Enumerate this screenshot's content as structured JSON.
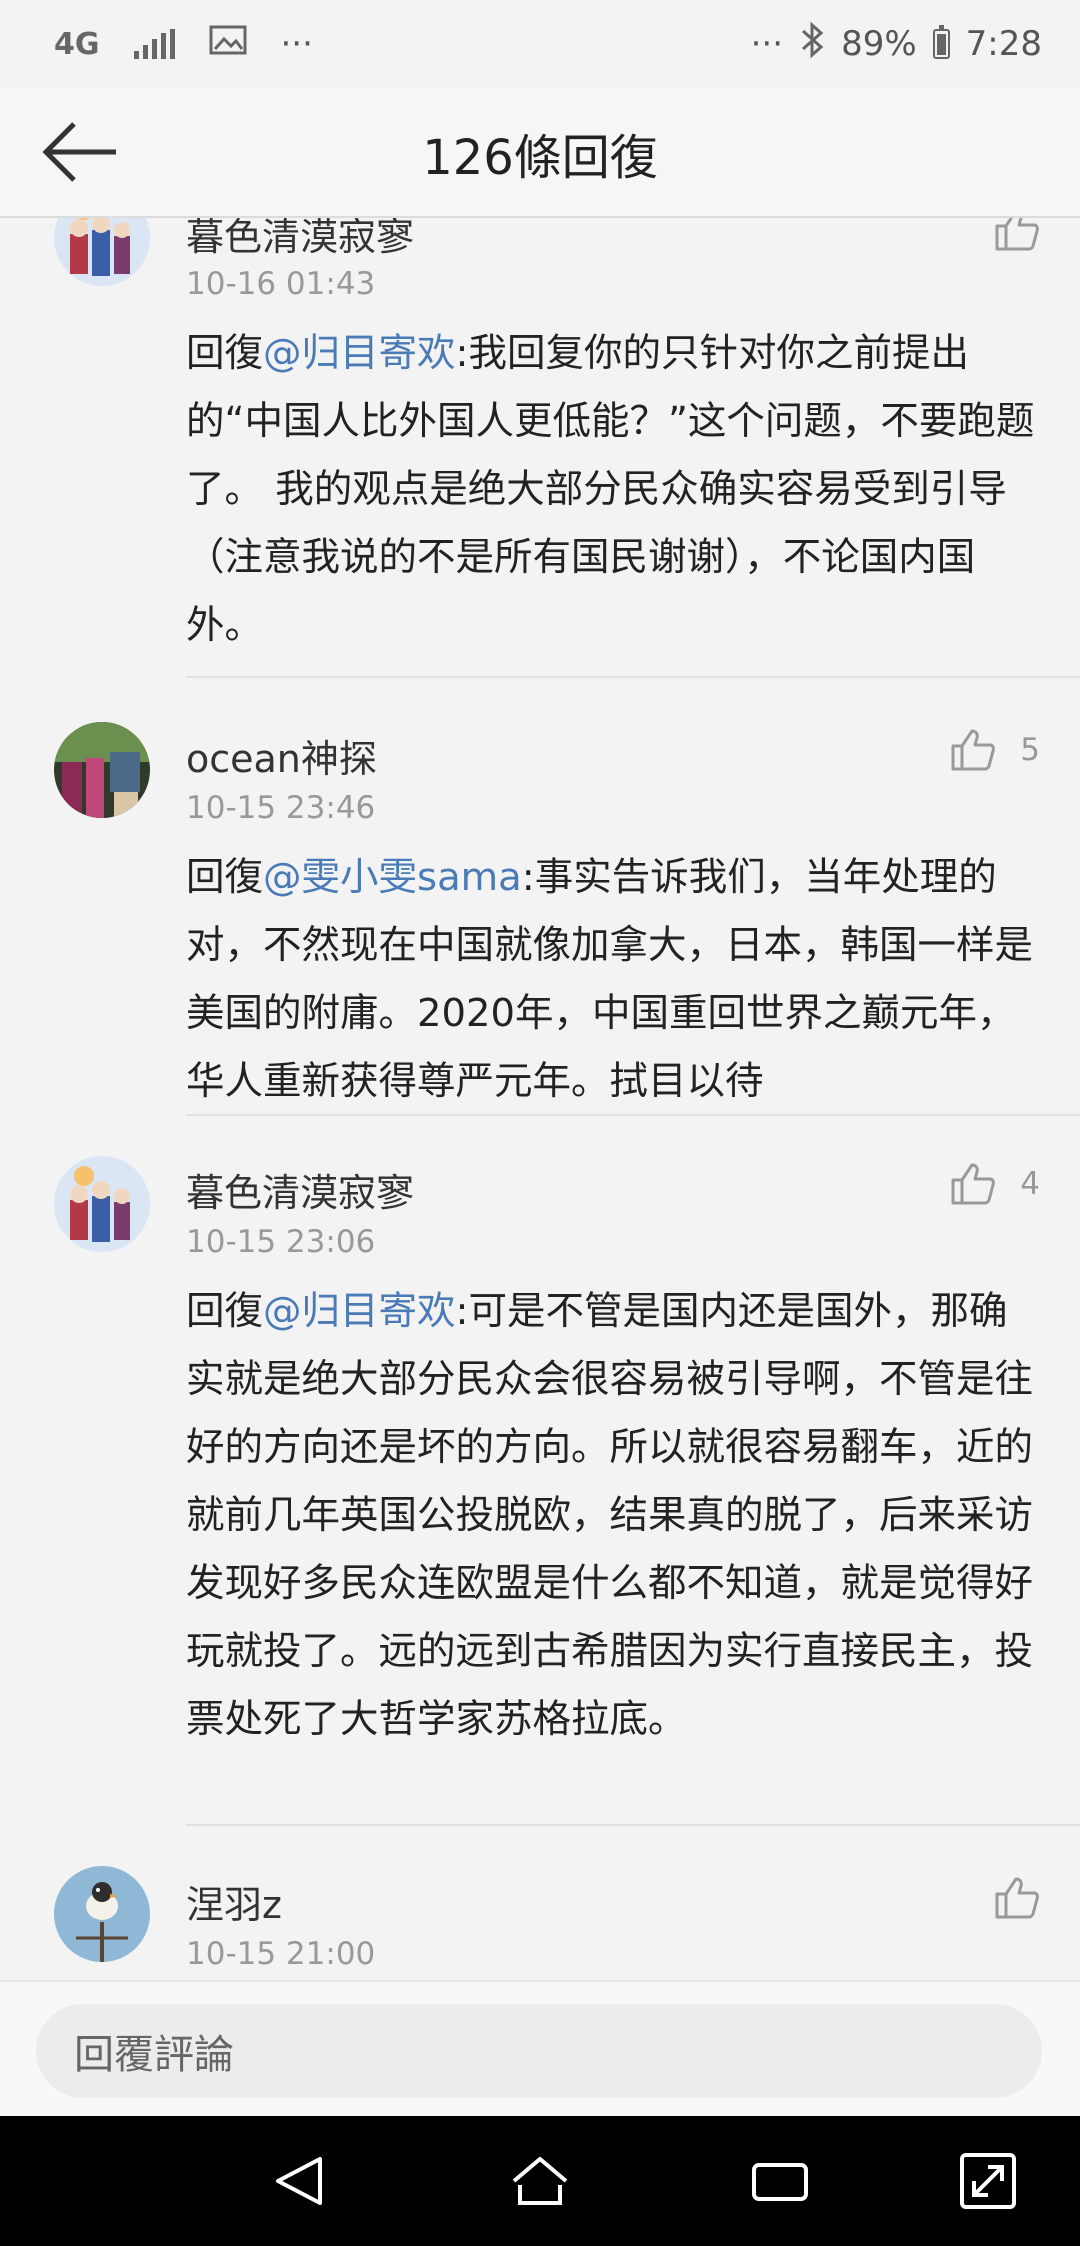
{
  "status_bar": {
    "network": "4G",
    "more": "···",
    "right_more": "···",
    "battery": "89%",
    "time": "7:28"
  },
  "header": {
    "title": "126條回復"
  },
  "comments": [
    {
      "name": "暮色清漠寂寥",
      "time": "10-16 01:43",
      "likes": "",
      "prefix": "回復",
      "mention": "@归目寄欢",
      "text": ":我回复你的只针对你之前提出的“中国人比外国人更低能？”这个问题，不要跑题了。 我的观点是绝大部分民众确实容易受到引导（注意我说的不是所有国民谢谢），不论国内国外。"
    },
    {
      "name": "ocean神探",
      "time": "10-15 23:46",
      "likes": "5",
      "prefix": "回復",
      "mention": "@雯小雯sama",
      "text": ":事实告诉我们，当年处理的对，不然现在中国就像加拿大，日本，韩国一样是美国的附庸。2020年，中国重回世界之巅元年，华人重新获得尊严元年。拭目以待"
    },
    {
      "name": "暮色清漠寂寥",
      "time": "10-15 23:06",
      "likes": "4",
      "prefix": "回復",
      "mention": "@归目寄欢",
      "text": ":可是不管是国内还是国外，那确实就是绝大部分民众会很容易被引导啊，不管是往好的方向还是坏的方向。所以就很容易翻车，近的就前几年英国公投脱欧，结果真的脱了，后来采访发现好多民众连欧盟是什么都不知道，就是觉得好玩就投了。远的远到古希腊因为实行直接民主，投票处死了大哲学家苏格拉底。"
    },
    {
      "name": "涅羽z",
      "time": "10-15 21:00",
      "likes": ""
    }
  ],
  "reply": {
    "placeholder": "回覆評論"
  },
  "icons": {
    "back": "back-arrow-icon",
    "like": "thumbs-up-icon",
    "bluetooth": "bluetooth-icon",
    "image": "image-icon",
    "nav_back": "triangle-back-icon",
    "nav_home": "home-icon",
    "nav_recent": "recent-apps-icon",
    "nav_expand": "expand-icon"
  }
}
